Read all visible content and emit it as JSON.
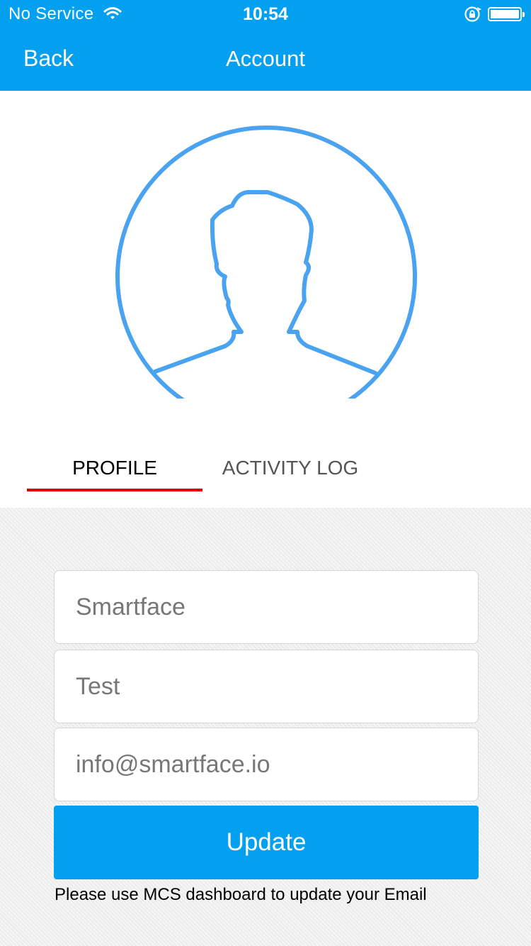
{
  "status_bar": {
    "carrier": "No Service",
    "time": "10:54",
    "icons": [
      "wifi-icon",
      "orientation-lock-icon",
      "battery-icon"
    ]
  },
  "nav": {
    "back_label": "Back",
    "title": "Account"
  },
  "avatar": {
    "icon": "user-silhouette-icon",
    "stroke_color": "#4aa3f0"
  },
  "tabs": [
    {
      "label": "PROFILE",
      "selected": true
    },
    {
      "label": "ACTIVITY LOG",
      "selected": false
    }
  ],
  "form": {
    "first_name": "Smartface",
    "last_name": "Test",
    "email": "info@smartface.io",
    "update_label": "Update",
    "note": "Please use MCS dashboard to update your Email"
  },
  "colors": {
    "accent": "#03a0ef",
    "tab_indicator": "#e00000"
  }
}
